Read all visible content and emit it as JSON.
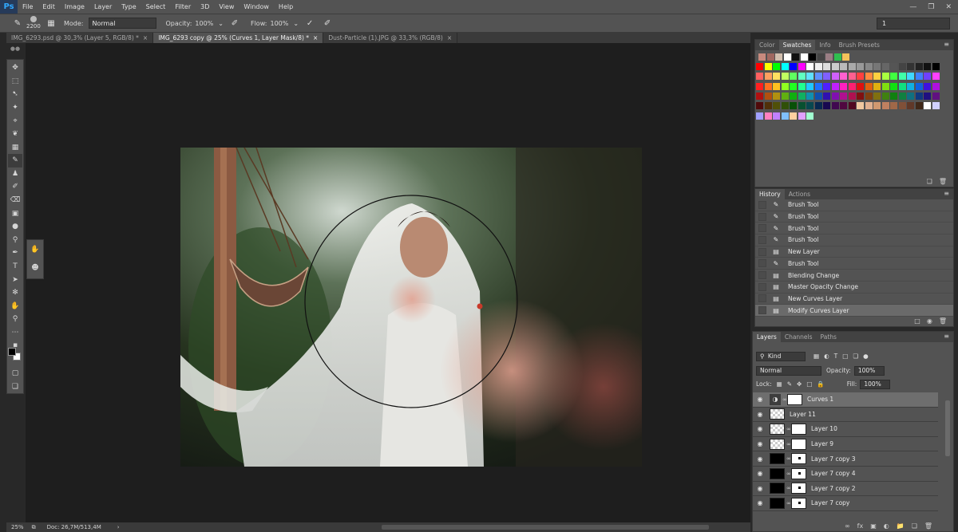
{
  "app": {
    "logo": "Ps"
  },
  "menu": [
    "File",
    "Edit",
    "Image",
    "Layer",
    "Type",
    "Select",
    "Filter",
    "3D",
    "View",
    "Window",
    "Help"
  ],
  "options": {
    "brush_size": "2200",
    "mode_label": "Mode:",
    "mode_value": "Normal",
    "opacity_label": "Opacity:",
    "opacity_value": "100%",
    "flow_label": "Flow:",
    "flow_value": "100%",
    "workspace_value": "1"
  },
  "doc_tabs": [
    {
      "label": "IMG_6293.psd @ 30,3% (Layer 5, RGB/8) *",
      "close": "×"
    },
    {
      "label": "IMG_6293 copy @ 25% (Curves 1, Layer Mask/8) *",
      "close": "×"
    },
    {
      "label": "Dust-Particle (1).JPG @ 33,3% (RGB/8)",
      "close": "×"
    }
  ],
  "status": {
    "zoom": "25%",
    "doc": "Doc: 26,7M/513,4M"
  },
  "swatches_panel": {
    "tabs": [
      "Color",
      "Swatches",
      "Info",
      "Brush Presets"
    ],
    "active_tab": "Swatches",
    "colors": [
      [
        "#c88a7e",
        "#a06860",
        "#d2bfae",
        "#ffffff",
        "#111111",
        "#ffffff",
        "#000000",
        "#444444",
        "#9a7e84",
        "#2fbf4f",
        "#f4c25a"
      ],
      [
        "#ff0000",
        "#ffff00",
        "#00ff00",
        "#00ffff",
        "#0000ff",
        "#ff00ff",
        "#ffffff",
        "#eeeeee",
        "#dddddd",
        "#cccccc",
        "#bbbbbb",
        "#aaaaaa",
        "#999999",
        "#888888",
        "#777777",
        "#666666",
        "#555555",
        "#444444",
        "#333333",
        "#222222",
        "#111111",
        "#000000"
      ],
      [
        "#ff6060",
        "#ffa060",
        "#ffe060",
        "#c0ff60",
        "#60ff60",
        "#60ffc0",
        "#60e0ff",
        "#6090ff",
        "#8060ff",
        "#d060ff",
        "#ff60d0",
        "#ff6090",
        "#ff4040",
        "#ff8a40",
        "#ffd040",
        "#a8ff40",
        "#40ff40",
        "#40ffa8",
        "#40d8ff",
        "#4080ff",
        "#7040ff",
        "#ff40ff"
      ],
      [
        "#ff2020",
        "#ff7020",
        "#ffc020",
        "#90ff20",
        "#20ff20",
        "#20ff90",
        "#20c8ff",
        "#2070ff",
        "#5020ff",
        "#c020ff",
        "#ff20c0",
        "#ff2070",
        "#e01010",
        "#e06010",
        "#e0b010",
        "#80e010",
        "#10e010",
        "#10e080",
        "#10b0e0",
        "#1060e0",
        "#4010e0",
        "#b010e0"
      ],
      [
        "#b01010",
        "#b05010",
        "#b09010",
        "#60b010",
        "#10b010",
        "#10b060",
        "#1090b0",
        "#1050b0",
        "#3010b0",
        "#8010b0",
        "#b01090",
        "#b01050",
        "#801010",
        "#804010",
        "#807010",
        "#408010",
        "#108010",
        "#108040",
        "#107080",
        "#103880",
        "#201080",
        "#601080"
      ],
      [
        "#500a0a",
        "#503008",
        "#505008",
        "#305008",
        "#085008",
        "#085030",
        "#084850",
        "#082850",
        "#180850",
        "#400850",
        "#500840",
        "#500820",
        "#f0c8a0",
        "#e0b090",
        "#d09870",
        "#c08060",
        "#a06848",
        "#805038",
        "#603828",
        "#402818",
        "#ffffff",
        "#d0d0ff"
      ],
      [
        "#a0a0ff",
        "#ff80c0",
        "#c080ff",
        "#80c0ff",
        "#ffd0a0",
        "#e0a0ff",
        "#a0ffd0"
      ]
    ]
  },
  "history_panel": {
    "tabs": [
      "History",
      "Actions"
    ],
    "active_tab": "History",
    "items": [
      {
        "label": "Brush Tool",
        "icon": "brush-icon"
      },
      {
        "label": "Brush Tool",
        "icon": "brush-icon"
      },
      {
        "label": "Brush Tool",
        "icon": "brush-icon"
      },
      {
        "label": "Brush Tool",
        "icon": "brush-icon"
      },
      {
        "label": "New Layer",
        "icon": "document-icon"
      },
      {
        "label": "Brush Tool",
        "icon": "brush-icon"
      },
      {
        "label": "Blending Change",
        "icon": "document-icon"
      },
      {
        "label": "Master Opacity Change",
        "icon": "document-icon"
      },
      {
        "label": "New Curves Layer",
        "icon": "document-icon"
      },
      {
        "label": "Modify Curves Layer",
        "icon": "document-icon"
      }
    ],
    "selected_index": 9
  },
  "layers_panel": {
    "tabs": [
      "Layers",
      "Channels",
      "Paths"
    ],
    "active_tab": "Layers",
    "filter_value": "Kind",
    "blend_mode": "Normal",
    "opacity_label": "Opacity:",
    "opacity_value": "100%",
    "lock_label": "Lock:",
    "fill_label": "Fill:",
    "fill_value": "100%",
    "layers": [
      {
        "name": "Curves 1",
        "kind": "adjustment"
      },
      {
        "name": "Layer 11",
        "kind": "pixel"
      },
      {
        "name": "Layer 10",
        "kind": "pixel-mask"
      },
      {
        "name": "Layer 9",
        "kind": "pixel-mask"
      },
      {
        "name": "Layer 7 copy 3",
        "kind": "pixel-mask"
      },
      {
        "name": "Layer 7 copy 4",
        "kind": "pixel-mask"
      },
      {
        "name": "Layer 7 copy 2",
        "kind": "pixel-mask"
      },
      {
        "name": "Layer 7 copy",
        "kind": "pixel-mask"
      }
    ],
    "selected_index": 0
  }
}
